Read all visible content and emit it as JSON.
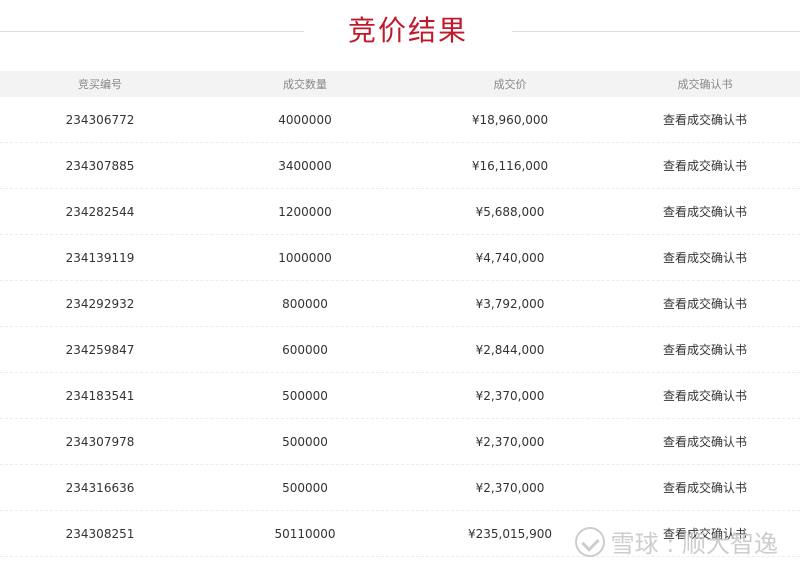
{
  "page": {
    "title": "竞价结果"
  },
  "table": {
    "headers": [
      "竞买编号",
      "成交数量",
      "成交价",
      "成交确认书"
    ],
    "rows": [
      {
        "id": "234306772",
        "qty": "4000000",
        "price": "¥18,960,000",
        "action": "查看成交确认书"
      },
      {
        "id": "234307885",
        "qty": "3400000",
        "price": "¥16,116,000",
        "action": "查看成交确认书"
      },
      {
        "id": "234282544",
        "qty": "1200000",
        "price": "¥5,688,000",
        "action": "查看成交确认书"
      },
      {
        "id": "234139119",
        "qty": "1000000",
        "price": "¥4,740,000",
        "action": "查看成交确认书"
      },
      {
        "id": "234292932",
        "qty": "800000",
        "price": "¥3,792,000",
        "action": "查看成交确认书"
      },
      {
        "id": "234259847",
        "qty": "600000",
        "price": "¥2,844,000",
        "action": "查看成交确认书"
      },
      {
        "id": "234183541",
        "qty": "500000",
        "price": "¥2,370,000",
        "action": "查看成交确认书"
      },
      {
        "id": "234307978",
        "qty": "500000",
        "price": "¥2,370,000",
        "action": "查看成交确认书"
      },
      {
        "id": "234316636",
        "qty": "500000",
        "price": "¥2,370,000",
        "action": "查看成交确认书"
      },
      {
        "id": "234308251",
        "qty": "50110000",
        "price": "¥235,015,900",
        "action": "查看成交确认书"
      }
    ]
  },
  "watermark": {
    "text": "雪球 : 顺大智逸"
  },
  "colors": {
    "title": "#c0192b",
    "header_bg": "#f3f3f3"
  }
}
